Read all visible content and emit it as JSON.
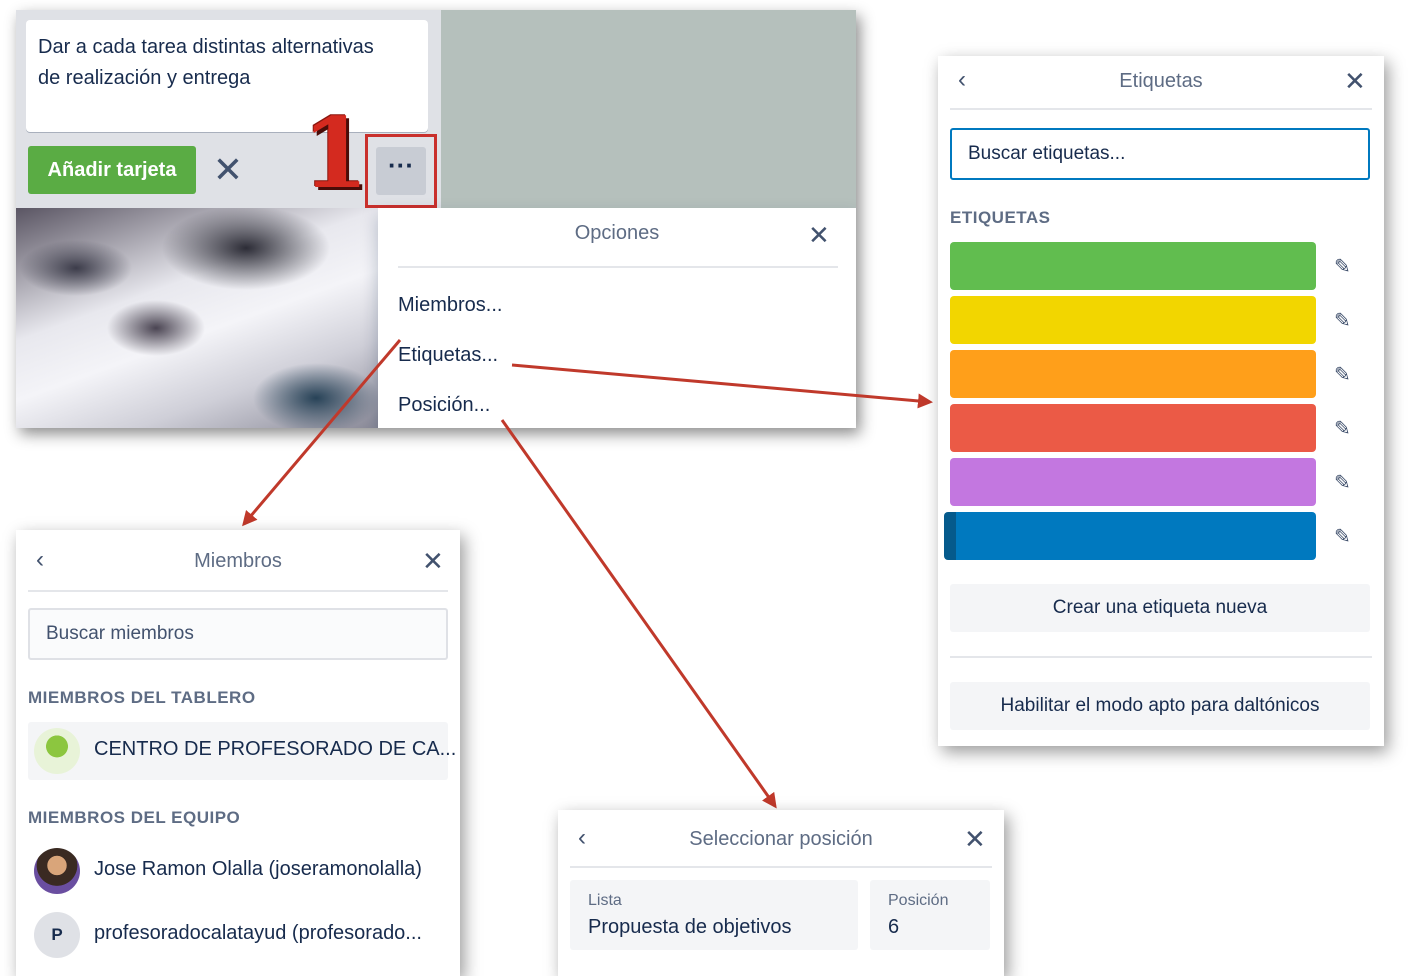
{
  "card": {
    "text_line1": "Dar a cada tarea distintas alternativas",
    "text_line2": "de realización y entrega",
    "add_button": "Añadir tarjeta",
    "close_glyph": "✕",
    "step_number": "1",
    "more_glyph": "···"
  },
  "options_menu": {
    "title": "Opciones",
    "close_glyph": "✕",
    "items": [
      "Miembros...",
      "Etiquetas...",
      "Posición..."
    ]
  },
  "labels_popover": {
    "title": "Etiquetas",
    "back_glyph": "‹",
    "close_glyph": "✕",
    "search_placeholder": "Buscar etiquetas...",
    "section": "ETIQUETAS",
    "colors": [
      "#61bd4f",
      "#f2d600",
      "#ff9f1a",
      "#eb5a46",
      "#c377e0",
      "#0079bf"
    ],
    "edit_icon": "pencil-icon",
    "edit_glyph": "✎",
    "create_button": "Crear una etiqueta nueva",
    "colorblind_button": "Habilitar el modo apto para daltónicos"
  },
  "members_popover": {
    "title": "Miembros",
    "back_glyph": "‹",
    "close_glyph": "✕",
    "search_placeholder": "Buscar miembros",
    "board_section": "MIEMBROS DEL TABLERO",
    "board_members": [
      "CENTRO DE PROFESORADO DE CA..."
    ],
    "team_section": "MIEMBROS DEL EQUIPO",
    "team_members": [
      "Jose Ramon Olalla (joseramonolalla)",
      "profesoradocalatayud (profesorado..."
    ],
    "avatar_initial": "P"
  },
  "position_popover": {
    "title": "Seleccionar posición",
    "back_glyph": "‹",
    "close_glyph": "✕",
    "list_label": "Lista",
    "list_value": "Propuesta de objetivos",
    "position_label": "Posición",
    "position_value": "6"
  },
  "colors": {
    "annotation_red": "#c9302c",
    "trello_green": "#5aac44",
    "trello_blue": "#0079bf"
  }
}
